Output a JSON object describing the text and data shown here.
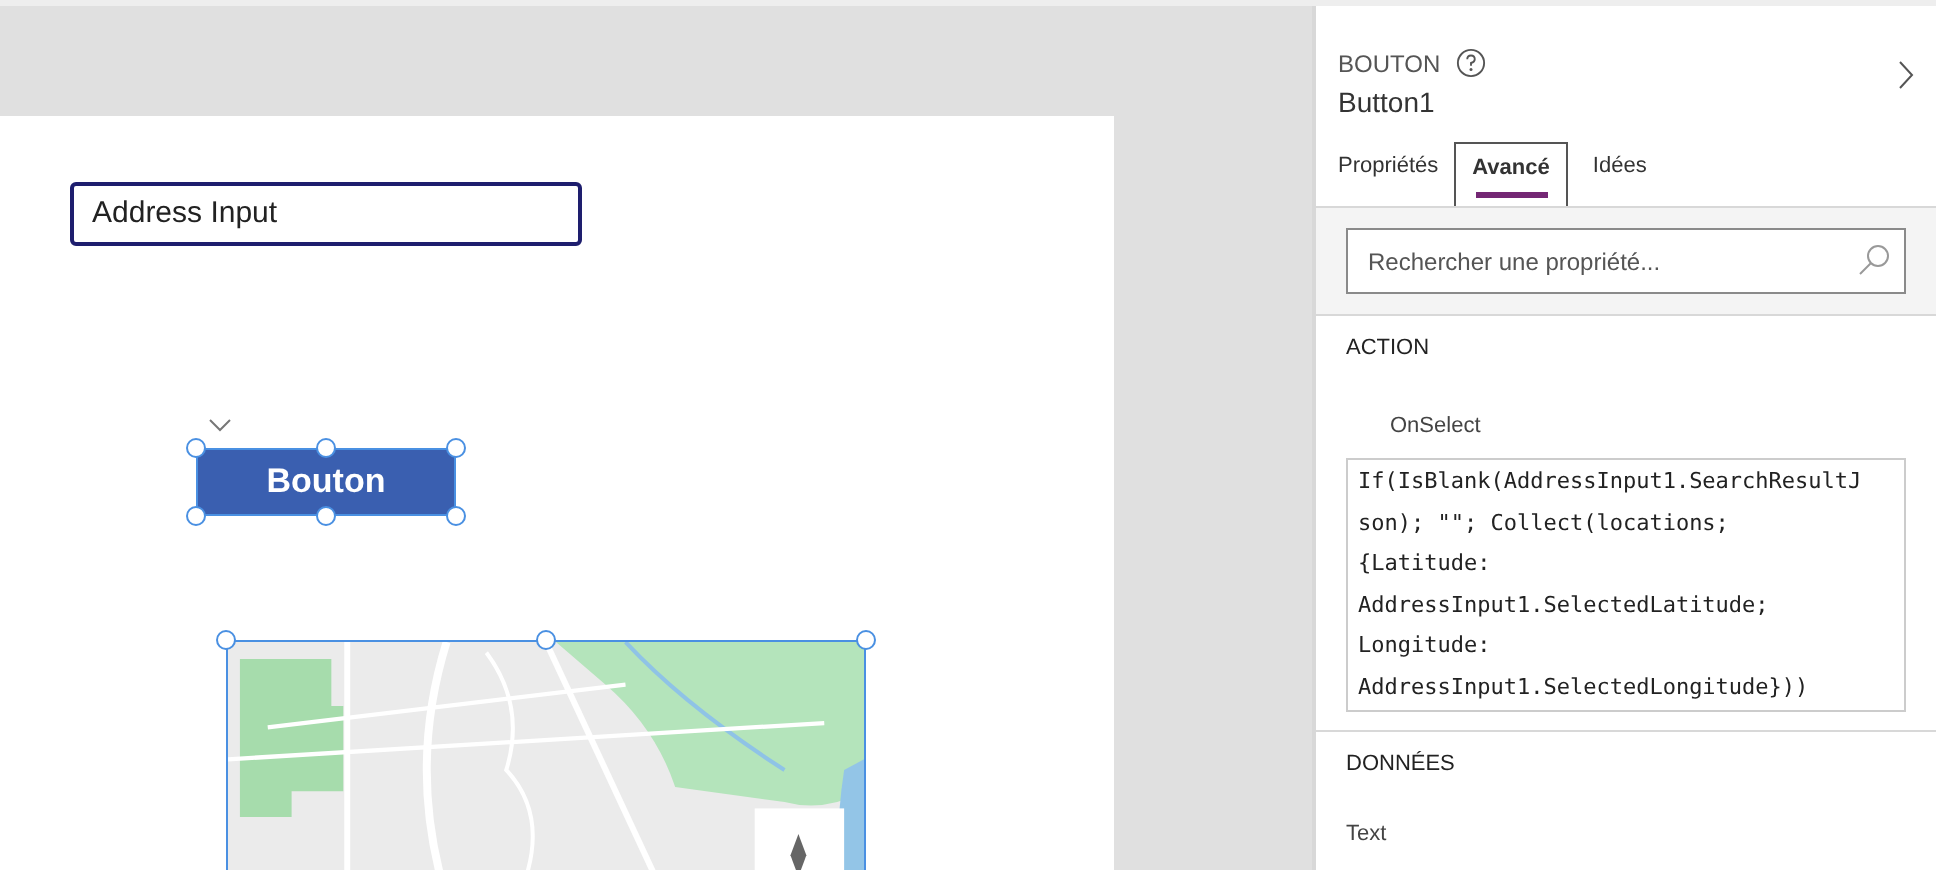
{
  "canvas": {
    "address_input": {
      "value": "Address Input"
    },
    "button": {
      "label": "Bouton",
      "selected": true
    },
    "map": {
      "kind": "picture",
      "selected": true
    }
  },
  "panel": {
    "type_label": "BOUTON",
    "control_name": "Button1",
    "tabs": [
      {
        "label": "Propriétés",
        "selected": false
      },
      {
        "label": "Avancé",
        "selected": true
      },
      {
        "label": "Idées",
        "selected": false
      }
    ],
    "search": {
      "placeholder": "Rechercher une propriété..."
    },
    "sections": [
      {
        "title": "ACTION",
        "property": "OnSelect",
        "formula_lines": [
          "If(IsBlank(AddressInput1.SearchResultJ",
          "son); \"\"; Collect(locations;",
          "{Latitude:",
          "AddressInput1.SelectedLatitude;",
          "Longitude:",
          "AddressInput1.SelectedLongitude}))"
        ]
      },
      {
        "title": "DONNÉES",
        "property": "Text"
      }
    ]
  }
}
